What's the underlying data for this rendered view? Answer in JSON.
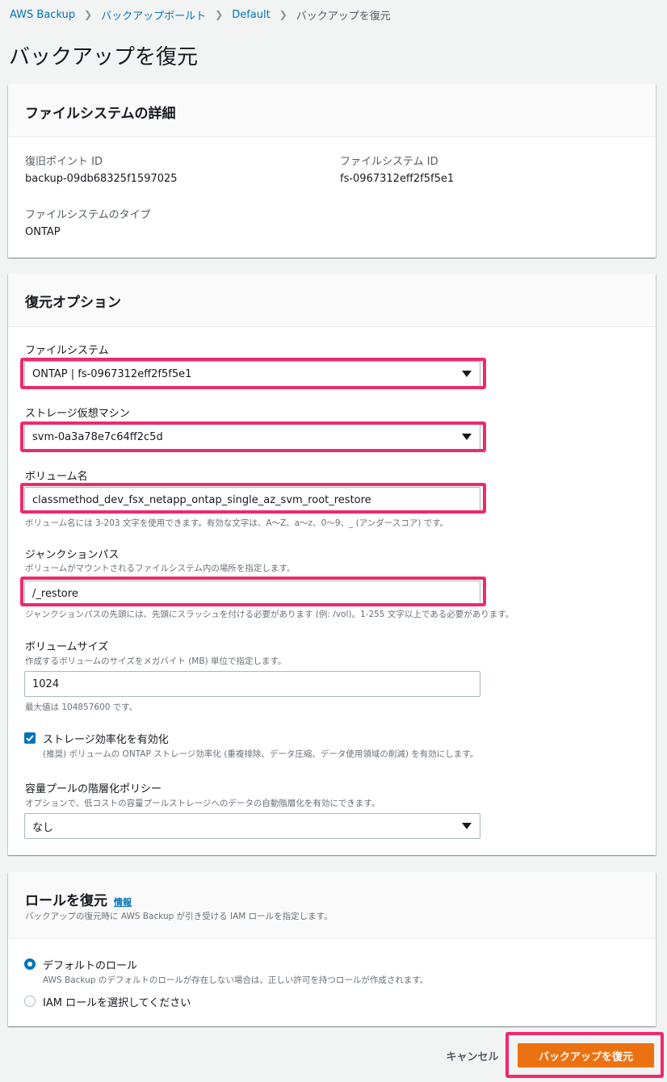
{
  "breadcrumb": {
    "items": [
      "AWS Backup",
      "バックアップボールト",
      "Default"
    ],
    "current": "バックアップを復元"
  },
  "page_title": "バックアップを復元",
  "fs_details": {
    "title": "ファイルシステムの詳細",
    "recovery_point_label": "復旧ポイント ID",
    "recovery_point_value": "backup-09db68325f1597025",
    "fs_id_label": "ファイルシステム ID",
    "fs_id_value": "fs-0967312eff2f5f5e1",
    "fs_type_label": "ファイルシステムのタイプ",
    "fs_type_value": "ONTAP"
  },
  "restore_options": {
    "title": "復元オプション",
    "file_system_label": "ファイルシステム",
    "file_system_value": "ONTAP | fs-0967312eff2f5f5e1",
    "svm_label": "ストレージ仮想マシン",
    "svm_value": "svm-0a3a78e7c64ff2c5d",
    "volume_name_label": "ボリューム名",
    "volume_name_value": "classmethod_dev_fsx_netapp_ontap_single_az_svm_root_restore",
    "volume_name_hint": "ボリューム名には 3-203 文字を使用できます。有効な文字は、A〜Z、a〜z、0〜9、_ (アンダースコア) です。",
    "junction_label": "ジャンクションパス",
    "junction_desc": "ボリュームがマウントされるファイルシステム内の場所を指定します。",
    "junction_value": "/_restore",
    "junction_hint": "ジャンクションパスの先頭には、先頭にスラッシュを付ける必要があります (例: /vol)。1-255 文字以上である必要があります。",
    "volume_size_label": "ボリュームサイズ",
    "volume_size_desc": "作成するボリュームのサイズをメガバイト (MB) 単位で指定します。",
    "volume_size_value": "1024",
    "volume_size_hint": "最大値は 104857600 です。",
    "storage_efficiency_label": "ストレージ効率化を有効化",
    "storage_efficiency_desc": "(推奨) ボリュームの ONTAP ストレージ効率化 (重複排除、データ圧縮、データ使用領域の削減) を有効にします。",
    "storage_efficiency_checked": true,
    "tiering_label": "容量プールの階層化ポリシー",
    "tiering_desc": "オプションで、低コストの容量プールストレージへのデータの自動階層化を有効にできます。",
    "tiering_value": "なし"
  },
  "restore_role": {
    "title": "ロールを復元",
    "info_link": "情報",
    "desc": "バックアップの復元時に AWS Backup が引き受ける IAM ロールを指定します。",
    "option_default_label": "デフォルトのロール",
    "option_default_desc": "AWS Backup のデフォルトのロールが存在しない場合は、正しい許可を持つロールが作成されます。",
    "option_iam_label": "IAM ロールを選択してください",
    "selected": "default"
  },
  "footer": {
    "cancel_label": "キャンセル",
    "submit_label": "バックアップを復元"
  },
  "colors": {
    "accent": "#0073bb",
    "primary_button": "#ec7211",
    "highlight": "#ee2a6e"
  }
}
